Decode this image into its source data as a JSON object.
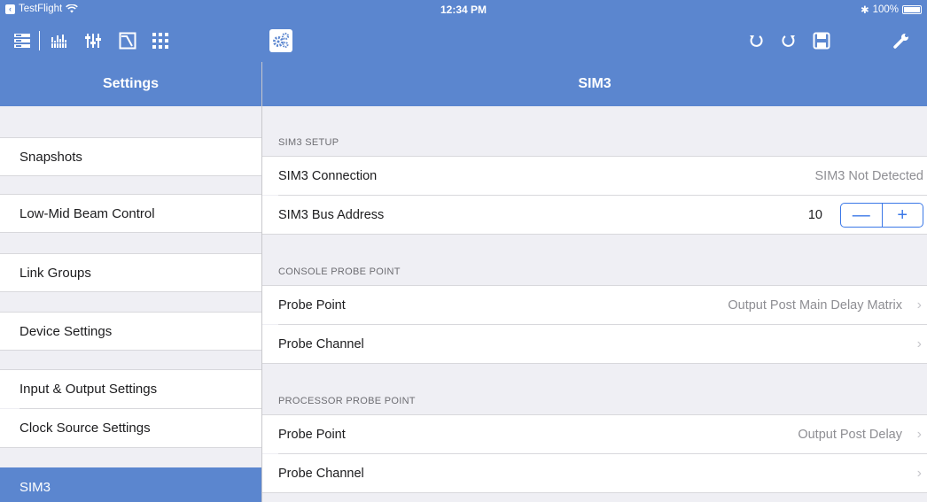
{
  "status_bar": {
    "app": "TestFlight",
    "time": "12:34 PM",
    "battery": "100%"
  },
  "toolbar": {
    "icons": [
      "scenes-icon",
      "meters-icon",
      "faders-icon",
      "eq-curve-icon",
      "grid-icon",
      "settings-gears-icon",
      "undo-icon",
      "redo-icon",
      "save-icon",
      "wrench-icon"
    ],
    "active": "settings-gears-icon"
  },
  "left_nav": {
    "title": "Settings",
    "items": [
      {
        "label": "Snapshots"
      },
      {
        "label": "Low-Mid Beam Control"
      },
      {
        "label": "Link Groups"
      },
      {
        "label": "Device Settings"
      },
      {
        "label": "Input & Output Settings"
      },
      {
        "label": "Clock Source Settings"
      },
      {
        "label": "SIM3"
      }
    ],
    "selected": "SIM3"
  },
  "detail": {
    "title": "SIM3",
    "sections": [
      {
        "header": "SIM3 SETUP",
        "rows": [
          {
            "label": "SIM3 Connection",
            "value": "SIM3 Not Detected"
          },
          {
            "label": "SIM3 Bus Address",
            "value": "10",
            "minus": "—",
            "plus": "+"
          }
        ]
      },
      {
        "header": "CONSOLE PROBE POINT",
        "rows": [
          {
            "label": "Probe Point",
            "value": "Output Post Main Delay Matrix"
          },
          {
            "label": "Probe Channel",
            "value": ""
          }
        ]
      },
      {
        "header": "PROCESSOR PROBE POINT",
        "rows": [
          {
            "label": "Probe Point",
            "value": "Output Post Delay"
          },
          {
            "label": "Probe Channel",
            "value": ""
          }
        ]
      }
    ]
  },
  "colors": {
    "accent": "#5b86cf",
    "stepper": "#3b78e7",
    "background": "#efeff4"
  }
}
